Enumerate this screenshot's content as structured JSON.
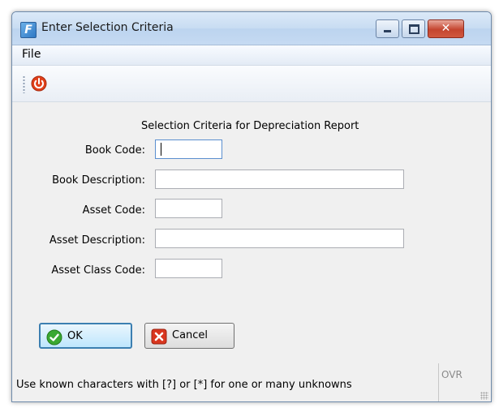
{
  "window": {
    "title": "Enter Selection Criteria",
    "app_icon_letter": "F",
    "controls": {
      "minimize": "minimize-icon",
      "maximize": "maximize-icon",
      "close": "close-icon",
      "close_glyph": "✕"
    }
  },
  "menubar": {
    "items": [
      {
        "label": "File"
      }
    ]
  },
  "toolbar": {
    "items": [
      {
        "icon": "power-icon",
        "color": "#e0401a"
      }
    ]
  },
  "form": {
    "title": "Selection Criteria for Depreciation Report",
    "fields": [
      {
        "label": "Book Code:",
        "value": "",
        "placeholder": ""
      },
      {
        "label": "Book Description:",
        "value": "",
        "placeholder": ""
      },
      {
        "label": "Asset Code:",
        "value": "",
        "placeholder": ""
      },
      {
        "label": "Asset Description:",
        "value": "",
        "placeholder": ""
      },
      {
        "label": "Asset Class Code:",
        "value": "",
        "placeholder": ""
      }
    ]
  },
  "buttons": {
    "ok": {
      "label": "OK",
      "icon": "check-icon",
      "color": "#3aa832"
    },
    "cancel": {
      "label": "Cancel",
      "icon": "cancel-x-icon",
      "color": "#d9361f"
    }
  },
  "statusbar": {
    "message": "Use known characters with [?] or [*] for one or many unknowns",
    "mode": "OVR"
  },
  "colors": {
    "title_bar": "#c8dcf2",
    "accent": "#3c7fb1",
    "window_bg": "#f0f0f0"
  }
}
